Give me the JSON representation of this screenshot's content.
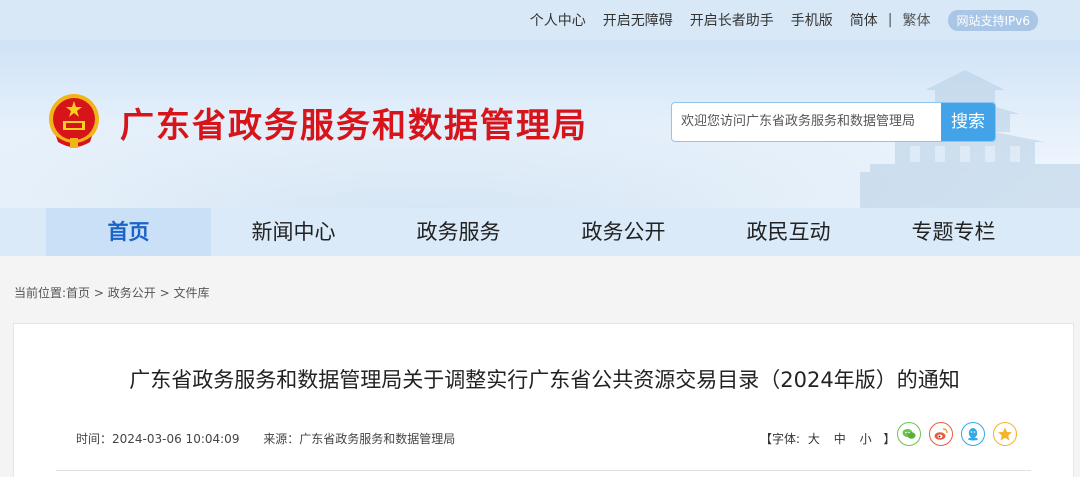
{
  "topbar": {
    "personal_center": "个人中心",
    "accessibility": "开启无障碍",
    "elder_mode": "开启长者助手",
    "mobile": "手机版",
    "simplified": "简体",
    "separator": "|",
    "traditional": "繁体",
    "ipv6": "网站支持IPv6"
  },
  "header": {
    "site_title": "广东省政务服务和数据管理局",
    "search_placeholder": "欢迎您访问广东省政务服务和数据管理局",
    "search_button": "搜索"
  },
  "nav": {
    "items": [
      {
        "label": "首页"
      },
      {
        "label": "新闻中心"
      },
      {
        "label": "政务服务"
      },
      {
        "label": "政务公开"
      },
      {
        "label": "政民互动"
      },
      {
        "label": "专题专栏"
      }
    ]
  },
  "breadcrumb": {
    "prefix": "当前位置:",
    "home": "首页",
    "sep": " > ",
    "level2": "政务公开",
    "level3": "文件库"
  },
  "article": {
    "title": "广东省政务服务和数据管理局关于调整实行广东省公共资源交易目录（2024年版）的通知",
    "time": "时间：2024-03-06 10:04:09",
    "source": "来源：广东省政务服务和数据管理局",
    "font_prefix": "【字体:",
    "font_large": "大",
    "font_medium": "中",
    "font_small": "小",
    "font_suffix": "】"
  },
  "share_icons": [
    "wechat-icon",
    "weibo-icon",
    "qq-icon",
    "qzone-icon"
  ],
  "colors": {
    "brand_red": "#d7141a",
    "accent_blue": "#42a3e8",
    "nav_active_text": "#1a63c7"
  }
}
